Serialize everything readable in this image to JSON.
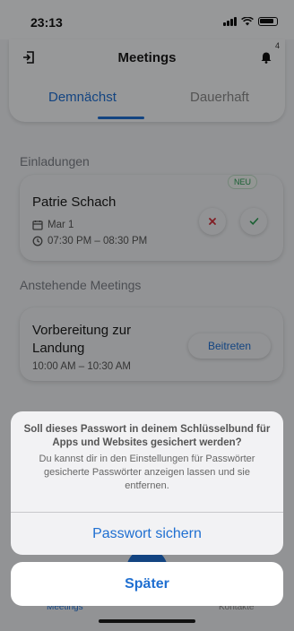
{
  "status_bar": {
    "time": "23:13"
  },
  "header": {
    "title": "Meetings",
    "notification_count": "4",
    "tabs": [
      {
        "label": "Demnächst",
        "active": true
      },
      {
        "label": "Dauerhaft",
        "active": false
      }
    ]
  },
  "invitations": {
    "section_title": "Einladungen",
    "items": [
      {
        "badge": "NEU",
        "name": "Patrie Schach",
        "date": "Mar 1",
        "time": "07:30 PM – 08:30 PM"
      }
    ]
  },
  "upcoming": {
    "section_title": "Anstehende Meetings",
    "items": [
      {
        "title": "Vorbereitung zur Landung",
        "time": "10:00 AM – 10:30 AM",
        "join_label": "Beitreten"
      }
    ]
  },
  "tab_bar": {
    "meetings_label": "Meetings",
    "contacts_label": "Kontakte"
  },
  "action_sheet": {
    "title": "Soll dieses Passwort in deinem Schlüsselbund für Apps und Websites gesichert werden?",
    "message": "Du kannst dir in den Einstellungen für Passwörter gesicherte Passwörter anzeigen lassen und sie entfernen.",
    "action_label": "Passwort sichern",
    "cancel_label": "Später"
  },
  "colors": {
    "accent": "#1f6fd1",
    "success": "#2a9b53",
    "danger": "#d0303a"
  }
}
